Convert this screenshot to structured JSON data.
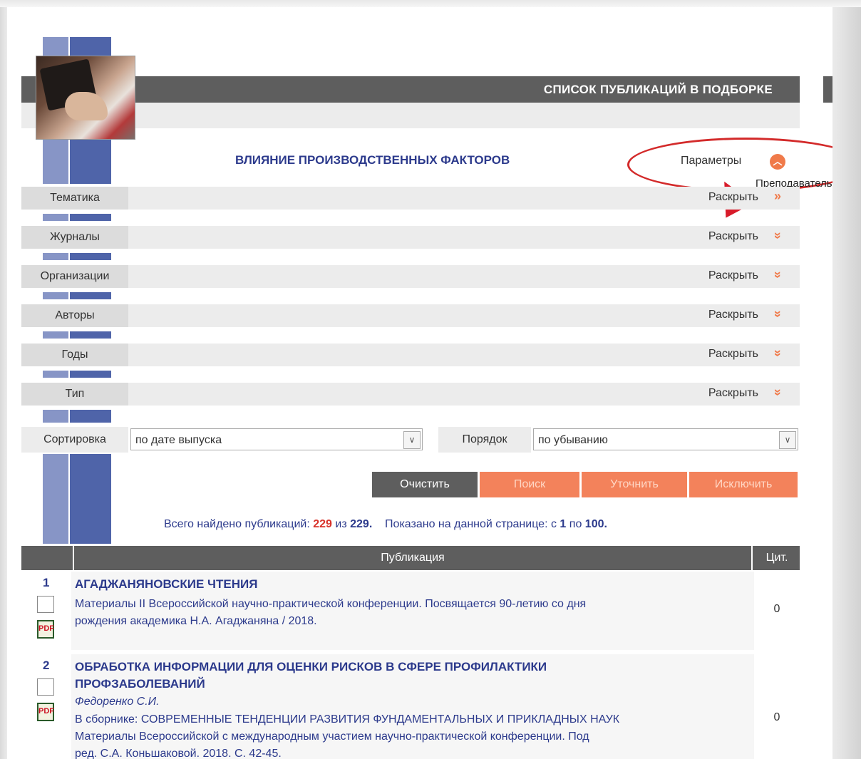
{
  "header": {
    "title": "СПИСОК ПУБЛИКАЦИЙ В ПОДБОРКЕ"
  },
  "collection": {
    "title": "ВЛИЯНИЕ ПРОИЗВОДСТВЕННЫХ ФАКТОРОВ",
    "params_label": "Параметры",
    "tooltip": "Преподаватель"
  },
  "filters": [
    {
      "label": "Тематика",
      "action": "Раскрыть"
    },
    {
      "label": "Журналы",
      "action": "Раскрыть"
    },
    {
      "label": "Организации",
      "action": "Раскрыть"
    },
    {
      "label": "Авторы",
      "action": "Раскрыть"
    },
    {
      "label": "Годы",
      "action": "Раскрыть"
    },
    {
      "label": "Тип",
      "action": "Раскрыть"
    }
  ],
  "sort": {
    "label": "Сортировка",
    "value": "по дате выпуска",
    "order_label": "Порядок",
    "order_value": "по убыванию"
  },
  "buttons": {
    "clear": "Очистить",
    "search": "Поиск",
    "refine": "Уточнить",
    "exclude": "Исключить"
  },
  "summary": {
    "prefix": "Всего найдено публикаций:",
    "found": "229",
    "of": "из",
    "total": "229.",
    "shown_prefix": "Показано на данной странице: с",
    "from": "1",
    "to_word": "по",
    "to": "100."
  },
  "table": {
    "col_publication": "Публикация",
    "col_citations": "Цит."
  },
  "publications": [
    {
      "num": "1",
      "title": "АГАДЖАНЯНОВСКИЕ ЧТЕНИЯ",
      "line1": "Материалы II Всероссийской научно-практической конференции. Посвящается 90-летию со дня",
      "line2": "рождения академика Н.А. Агаджаняна / 2018.",
      "citations": "0"
    },
    {
      "num": "2",
      "title_line1": "ОБРАБОТКА ИНФОРМАЦИИ ДЛЯ ОЦЕНКИ РИСКОВ В СФЕРЕ ПРОФИЛАКТИКИ",
      "title_line2": "ПРОФЗАБОЛЕВАНИЙ",
      "author": "Федоренко С.И.",
      "line1": "В сборнике: СОВРЕМЕННЫЕ ТЕНДЕНЦИИ РАЗВИТИЯ ФУНДАМЕНТАЛЬНЫХ И ПРИКЛАДНЫХ НАУК",
      "line2": "Материалы Всероссийской с международным участием научно-практической конференции. Под",
      "line3": "ред. С.А. Коньшаковой. 2018. С. 42-45.",
      "citations": "0"
    }
  ]
}
